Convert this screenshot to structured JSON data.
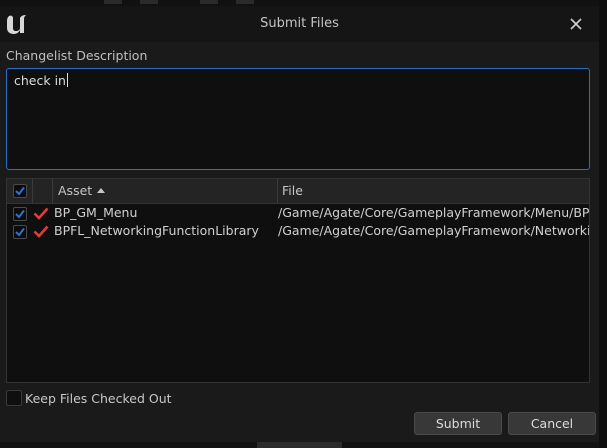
{
  "window": {
    "title": "Submit Files"
  },
  "description": {
    "label": "Changelist Description",
    "value": "check in"
  },
  "table": {
    "columns": [
      {
        "label": "Asset",
        "sort": "ascending"
      },
      {
        "label": "File"
      }
    ],
    "header_checkbox_checked": true,
    "rows": [
      {
        "checked": true,
        "status": "checked-out-icon",
        "asset": "BP_GM_Menu",
        "file": "/Game/Agate/Core/GameplayFramework/Menu/BP_G"
      },
      {
        "checked": true,
        "status": "checked-out-icon",
        "asset": "BPFL_NetworkingFunctionLibrary",
        "file": "/Game/Agate/Core/GameplayFramework/Networking/"
      }
    ]
  },
  "keep_checked_out": {
    "label": "Keep Files Checked Out",
    "checked": false
  },
  "buttons": {
    "submit": "Submit",
    "cancel": "Cancel"
  },
  "colors": {
    "accent": "#2d6fc7",
    "checkmark": "#2b73d6",
    "status_check": "#e23b3b"
  }
}
